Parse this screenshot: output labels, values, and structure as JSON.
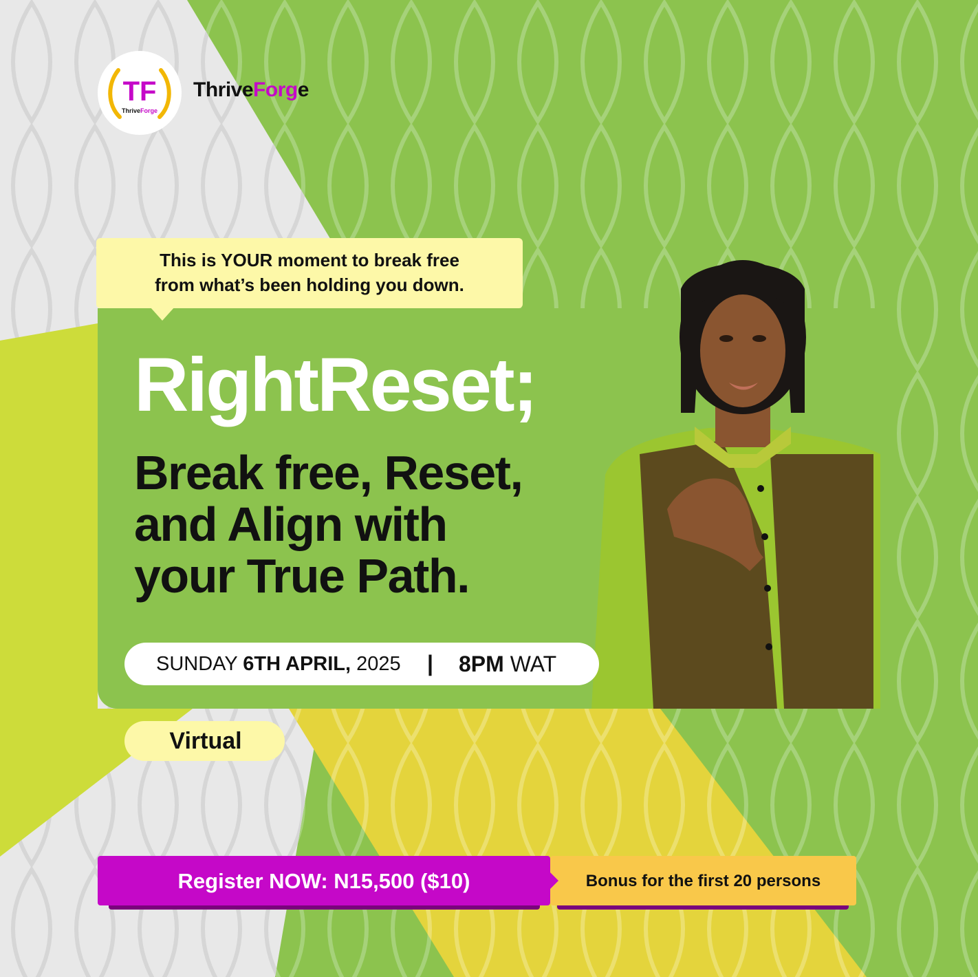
{
  "brand": {
    "logo_initials": "TF",
    "logo_caption_prefix": "Thrive",
    "logo_caption_accent": "Forge",
    "name_prefix": "Thrive",
    "name_accent": "Forg",
    "name_suffix": "e"
  },
  "bubble": {
    "line1": "This is YOUR moment to break free",
    "line2": "from what’s been holding you down."
  },
  "title": "RightReset;",
  "subtitle": {
    "line1": "Break free, Reset,",
    "line2": "and Align with",
    "line3": "your True Path."
  },
  "event": {
    "day": "SUNDAY",
    "date": "6TH APRIL,",
    "year": "2025",
    "separator": "|",
    "time": "8PM",
    "timezone": "WAT"
  },
  "mode": "Virtual",
  "cta": {
    "register": "Register NOW: N15,500 ($10)",
    "bonus": "Bonus for the first 20 persons"
  },
  "colors": {
    "green": "#8cc34e",
    "lime": "#cddc3a",
    "yellow": "#e4d43c",
    "grey": "#e8e8e8",
    "magenta": "#c508c8",
    "cream": "#fdf8a8",
    "amber": "#f9c84a"
  },
  "icons": {
    "logo": "thriveforge-logo",
    "portrait": "woman-portrait"
  }
}
